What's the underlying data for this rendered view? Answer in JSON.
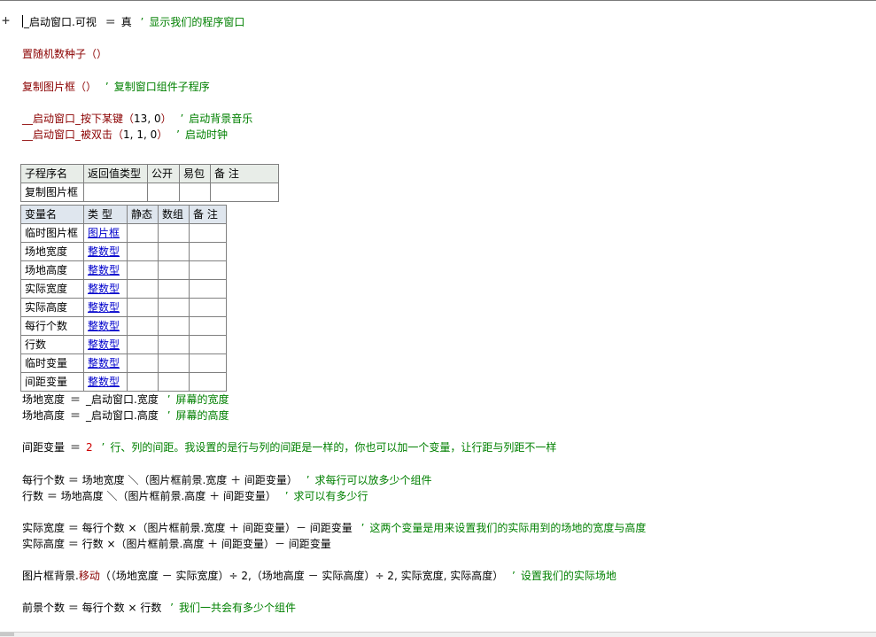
{
  "editor": {
    "expander": "+",
    "lines": {
      "l1": {
        "obj": "_启动窗口",
        "dot": ".",
        "prop": "可视",
        "eq": "＝",
        "val": "真",
        "q": "’",
        "comment": "显示我们的程序窗口"
      },
      "l2": {
        "fn": "置随机数种子",
        "args": "（）"
      },
      "l3": {
        "fn": "复制图片框",
        "args": "（）",
        "q": "’",
        "comment": "复制窗口组件子程序"
      },
      "l4": {
        "fn": "__启动窗口_按下某键",
        "args_open": "（",
        "a1": "13",
        "sep": ",",
        "a2": "0",
        "args_close": "）",
        "q": "’",
        "comment": "启动背景音乐"
      },
      "l5": {
        "fn": "__启动窗口_被双击",
        "args_open": "（",
        "a1": "1",
        "sep1": ",",
        "a2": "1",
        "sep2": ",",
        "a3": "0",
        "args_close": "）",
        "q": "’",
        "comment": "启动时钟"
      }
    },
    "sub_table": {
      "headers": [
        "子程序名",
        "返回值类型",
        "公开",
        "易包",
        "备 注"
      ],
      "row": [
        "复制图片框",
        "",
        "",
        "",
        ""
      ]
    },
    "var_table": {
      "headers": [
        "变量名",
        "类 型",
        "静态",
        "数组",
        "备 注"
      ],
      "rows": [
        {
          "name": "临时图片框",
          "type": "图片框"
        },
        {
          "name": "场地宽度",
          "type": "整数型"
        },
        {
          "name": "场地高度",
          "type": "整数型"
        },
        {
          "name": "实际宽度",
          "type": "整数型"
        },
        {
          "name": "实际高度",
          "type": "整数型"
        },
        {
          "name": "每行个数",
          "type": "整数型"
        },
        {
          "name": "行数",
          "type": "整数型"
        },
        {
          "name": "临时变量",
          "type": "整数型"
        },
        {
          "name": "间距变量",
          "type": "整数型"
        }
      ]
    },
    "code": {
      "c1": {
        "lhs": "场地宽度",
        "eq": "＝",
        "rhs": "_启动窗口.宽度",
        "q": "’",
        "comment": "屏幕的宽度"
      },
      "c2": {
        "lhs": "场地高度",
        "eq": "＝",
        "rhs": "_启动窗口.高度",
        "q": "’",
        "comment": "屏幕的高度"
      },
      "c3": {
        "lhs": "间距变量",
        "eq": "＝",
        "val": "2",
        "q": "’",
        "comment": "行、列的间距。我设置的是行与列的间距是一样的，你也可以加一个变量，让行距与列距不一样"
      },
      "c4": {
        "text": "每行个数 ＝ 场地宽度 ＼（图片框前景.宽度 ＋ 间距变量）",
        "q": "’",
        "comment": "求每行可以放多少个组件"
      },
      "c5": {
        "text": "行数 ＝ 场地高度 ＼（图片框前景.高度 ＋ 间距变量）",
        "q": "’",
        "comment": "求可以有多少行"
      },
      "c6": {
        "text": "实际宽度 ＝ 每行个数 ×（图片框前景.宽度 ＋ 间距变量）－ 间距变量",
        "q": "’",
        "comment": "这两个变量是用来设置我们的实际用到的场地的宽度与高度"
      },
      "c7": {
        "text": "实际高度 ＝ 行数 ×（图片框前景.高度 ＋ 间距变量）－ 间距变量"
      },
      "c8": {
        "obj": "图片框背景",
        "dot": ".",
        "method": "移动",
        "args": "（（场地宽度 － 实际宽度）÷ 2,（场地高度 － 实际高度）÷ 2, 实际宽度, 实际高度）",
        "q": "’",
        "comment": "设置我们的实际场地"
      },
      "c9": {
        "text": "前景个数 ＝ 每行个数 × 行数",
        "q": "’",
        "comment": "我们一共会有多少个组件"
      }
    }
  }
}
